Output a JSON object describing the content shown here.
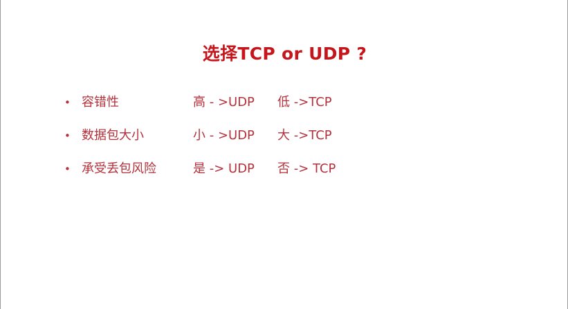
{
  "slide": {
    "title": "选择TCP or UDP ?",
    "rows": [
      {
        "label": "容错性",
        "high": "高 - >UDP",
        "low": "低 ->TCP"
      },
      {
        "label": "数据包大小",
        "high": "小 - >UDP",
        "low": "大 ->TCP"
      },
      {
        "label": "承受丢包风险",
        "high": "是 -> UDP",
        "low": "否 -> TCP"
      }
    ],
    "bullet": "•"
  },
  "colors": {
    "title": "#c4161c",
    "body_text": "#b5303a",
    "border": "#9a9a9a",
    "background": "#ffffff"
  }
}
